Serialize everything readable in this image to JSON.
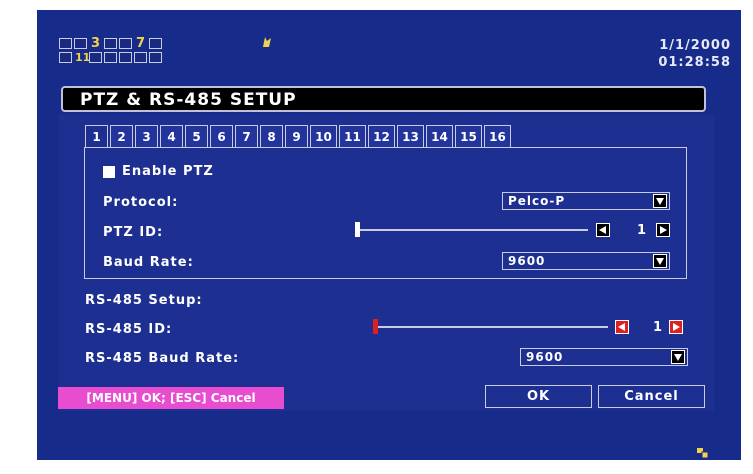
{
  "status": {
    "cam_row1": [
      "",
      "",
      "3",
      "",
      "",
      "7",
      ""
    ],
    "cam_row2": [
      "",
      "11",
      "",
      "",
      "",
      "",
      ""
    ],
    "date": "1/1/2000",
    "time": "01:28:58"
  },
  "dialog": {
    "title": "PTZ & RS-485 SETUP",
    "tabs": [
      "1",
      "2",
      "3",
      "4",
      "5",
      "6",
      "7",
      "8",
      "9",
      "10",
      "11",
      "12",
      "13",
      "14",
      "15",
      "16"
    ],
    "active_tab": "1"
  },
  "ptz": {
    "enable_label": "Enable PTZ",
    "protocol_label": "Protocol:",
    "protocol_value": "Pelco-P",
    "id_label": "PTZ ID:",
    "id_value": "1",
    "baud_label": "Baud Rate:",
    "baud_value": "9600"
  },
  "rs485": {
    "section_label": "RS-485 Setup:",
    "id_label": "RS-485 ID:",
    "id_value": "1",
    "baud_label": "RS-485 Baud Rate:",
    "baud_value": "9600"
  },
  "footer": {
    "hint": "[MENU] OK; [ESC] Cancel",
    "ok_label": "OK",
    "cancel_label": "Cancel"
  },
  "colors": {
    "background": "#162b8a",
    "accent_yellow": "#f2d24b",
    "hint_pink": "#e84ccf",
    "slider_red": "#e02020"
  },
  "icons": [
    "record-indicator-icon",
    "checkbox-icon",
    "dropdown-arrow-icon",
    "left-arrow-icon",
    "right-arrow-icon",
    "multi-window-icon"
  ]
}
